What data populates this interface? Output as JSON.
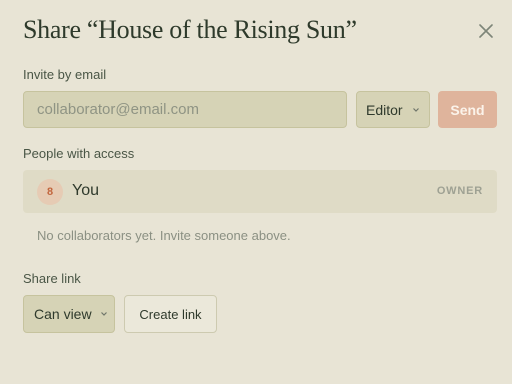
{
  "dialog": {
    "title": "Share “House of the Rising Sun”",
    "close_icon": "close-icon"
  },
  "invite": {
    "label": "Invite by email",
    "email_placeholder": "collaborator@email.com",
    "email_value": "",
    "role_value": "Editor",
    "send_label": "Send"
  },
  "access": {
    "label": "People with access",
    "people": [
      {
        "avatar_text": "8",
        "name": "You",
        "role": "OWNER"
      }
    ],
    "empty_note": "No collaborators yet. Invite someone above."
  },
  "share_link": {
    "label": "Share link",
    "permission_value": "Can view",
    "create_label": "Create link"
  },
  "colors": {
    "background": "#e8e4d5",
    "field": "#d6d3b6",
    "accent": "#dfb49c",
    "text": "#2f3a2c"
  }
}
